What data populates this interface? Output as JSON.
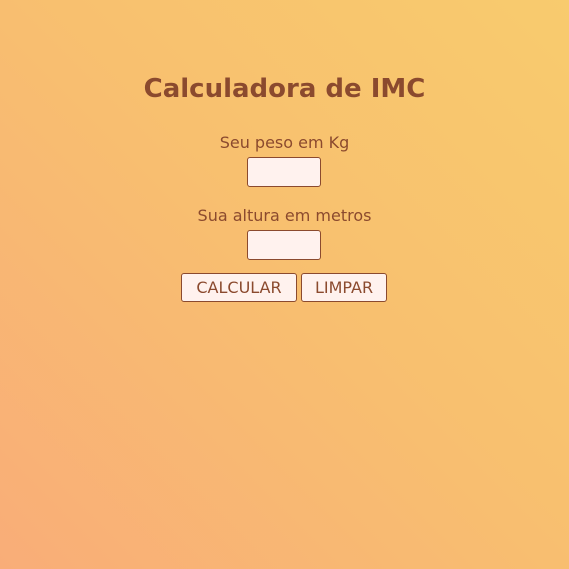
{
  "page": {
    "title": "Calculadora de IMC"
  },
  "form": {
    "weight_label": "Seu peso em Kg",
    "weight_value": "",
    "height_label": "Sua altura em metros",
    "height_value": "",
    "calculate_label": "CALCULAR",
    "clear_label": "LIMPAR"
  },
  "colors": {
    "text": "#8b4a2e",
    "field_background": "#fff2ee",
    "background_start": "#f9ad78",
    "background_end": "#f8cb6e"
  }
}
